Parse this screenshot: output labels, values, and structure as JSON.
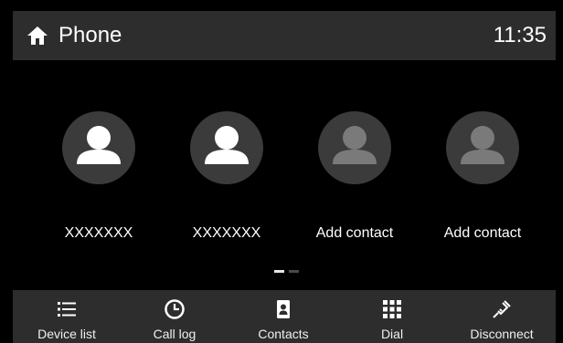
{
  "header": {
    "home_icon": "home-icon",
    "title": "Phone",
    "time": "11:35"
  },
  "contacts": [
    {
      "name": "XXXXXXX",
      "state": "saved",
      "icon": "person-icon"
    },
    {
      "name": "XXXXXXX",
      "state": "saved",
      "icon": "person-icon"
    },
    {
      "name": "Add contact",
      "state": "empty",
      "icon": "person-icon"
    },
    {
      "name": "Add contact",
      "state": "empty",
      "icon": "person-icon"
    }
  ],
  "pager": {
    "current_page": 1,
    "page_count": 2
  },
  "bottom_bar": {
    "items": [
      {
        "label": "Device list",
        "icon": "list-icon"
      },
      {
        "label": "Call log",
        "icon": "clock-icon"
      },
      {
        "label": "Contacts",
        "icon": "contacts-book-icon"
      },
      {
        "label": "Dial",
        "icon": "dialpad-icon"
      },
      {
        "label": "Disconnect",
        "icon": "disconnect-icon"
      }
    ]
  },
  "colors": {
    "background": "#000000",
    "bar": "#2d2d2d",
    "avatar_bg": "#3b3b3b",
    "person_saved": "#ffffff",
    "person_empty": "#7a7a7a",
    "text": "#ffffff"
  }
}
